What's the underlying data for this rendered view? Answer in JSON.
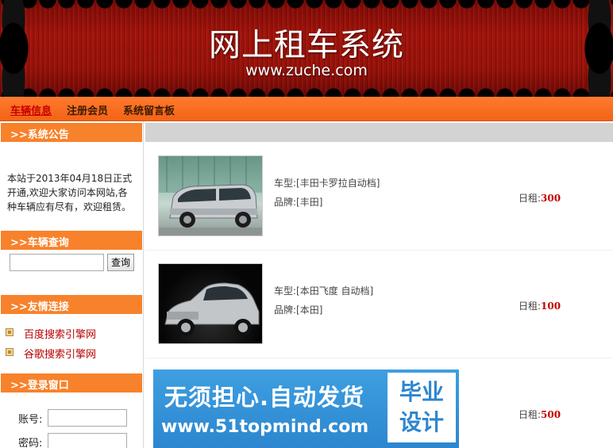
{
  "header": {
    "title": "网上租车系统",
    "url": "www.zuche.com"
  },
  "nav": {
    "items": [
      {
        "label": "车辆信息",
        "active": true
      },
      {
        "label": "注册会员",
        "active": false
      },
      {
        "label": "系统留言板",
        "active": false
      }
    ]
  },
  "sidebar": {
    "notice": {
      "heading": ">>系统公告",
      "text": "本站于2013年04月18日正式开通,欢迎大家访问本网站,各种车辆应有尽有，欢迎租赁。"
    },
    "search": {
      "heading": ">>车辆查询",
      "input_value": "",
      "button_label": "查询"
    },
    "links": {
      "heading": ">>友情连接",
      "items": [
        "百度搜索引擎网",
        "谷歌搜索引擎网"
      ]
    },
    "login": {
      "heading": ">>登录窗口",
      "username_label": "账号:",
      "password_label": "密码:"
    }
  },
  "main": {
    "cars": [
      {
        "model_label": "车型:",
        "model": "[丰田卡罗拉自动档]",
        "brand_label": "品牌:",
        "brand": "[丰田]",
        "rent_label": "日租:",
        "rent": "300",
        "photo": "silver-minivan-photo"
      },
      {
        "model_label": "车型:",
        "model": "[本田飞度 自动档]",
        "brand_label": "品牌:",
        "brand": "[本田]",
        "rent_label": "日租:",
        "rent": "100",
        "photo": "silver-sedan-photo"
      },
      {
        "rent_label": "日租:",
        "rent": "500"
      }
    ],
    "ad": {
      "line1": "无须担心.自动发货",
      "line2": "www.51topmind.com",
      "badge": "毕业\n设计"
    }
  },
  "colors": {
    "nav_bar": "#f36317",
    "side_heading": "#f8822b",
    "link_text": "#b80000",
    "price": "#c40000",
    "banner": "#9a120a",
    "ad_blue": "#2d86cf"
  }
}
